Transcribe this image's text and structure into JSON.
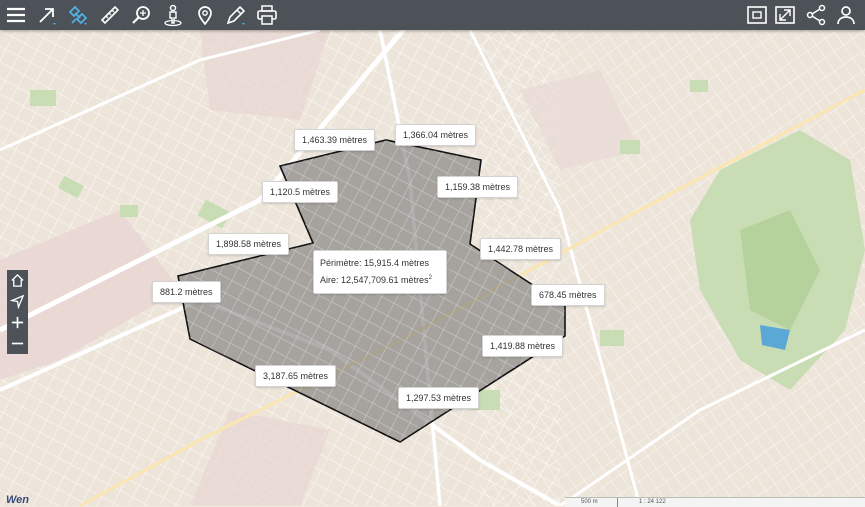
{
  "toolbar": {
    "left_tools": [
      {
        "name": "menu-icon"
      },
      {
        "name": "navigate-arrow-icon"
      },
      {
        "name": "satellite-icon"
      },
      {
        "name": "measure-ruler-icon"
      },
      {
        "name": "zoom-search-icon"
      },
      {
        "name": "street-view-person-icon"
      },
      {
        "name": "location-pin-icon"
      },
      {
        "name": "draw-tool-icon"
      },
      {
        "name": "print-icon"
      }
    ],
    "right_tools": [
      {
        "name": "window-icon"
      },
      {
        "name": "fullscreen-icon"
      },
      {
        "name": "share-icon"
      },
      {
        "name": "user-icon"
      }
    ],
    "icon_color": "#ffffff",
    "accent_color": "#4fb2e8"
  },
  "map": {
    "segment_labels": [
      "1,463.39 mètres",
      "1,366.04 mètres",
      "1,120.5 mètres",
      "1,159.38 mètres",
      "1,898.58 mètres",
      "1,442.78 mètres",
      "881.2 mètres",
      "678.45 mètres",
      "1,419.88 mètres",
      "3,187.65 mètres",
      "1,297.53 mètres"
    ],
    "measurement": {
      "perimeter": "Périmètre: 15,915.4 mètres",
      "area": "Aire: 12,547,709.61 mètres",
      "area_unit_sup": "2"
    },
    "polygon_fill": "#6b6b6b",
    "park_color": "#c9ddb4",
    "road_color": "#ffffff"
  },
  "zoom_controls": [
    {
      "name": "home-icon"
    },
    {
      "name": "locate-me-icon"
    },
    {
      "name": "zoom-in-icon"
    },
    {
      "name": "zoom-out-icon"
    }
  ],
  "scale": {
    "distance": "500 m",
    "ratio": "1 : 24 122"
  },
  "watermark": "Wen"
}
